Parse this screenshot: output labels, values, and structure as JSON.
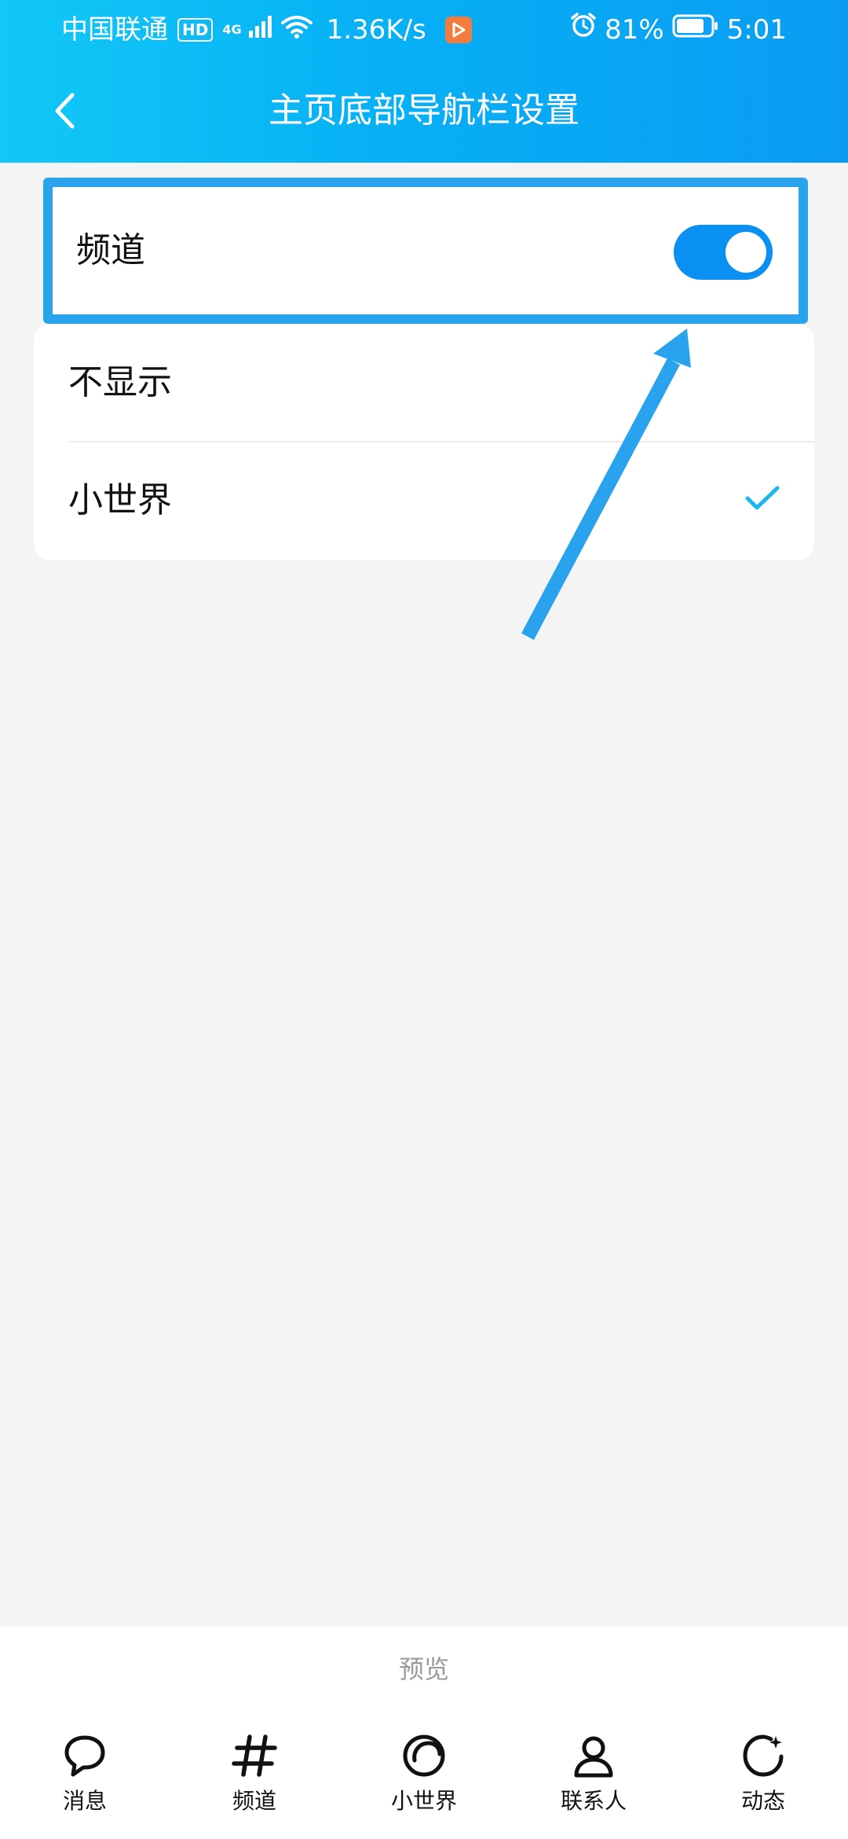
{
  "status_bar": {
    "carrier": "中国联通",
    "hd_badge": "HD",
    "network_badge": "4G",
    "speed": "1.36K/s",
    "battery_percent": "81%",
    "time": "5:01",
    "battery_level": 0.81
  },
  "header": {
    "title": "主页底部导航栏设置"
  },
  "channel_toggle": {
    "label": "频道",
    "on": true
  },
  "options": [
    {
      "label": "不显示",
      "selected": false
    },
    {
      "label": "小世界",
      "selected": true
    }
  ],
  "preview": {
    "label": "预览",
    "nav_items": [
      {
        "label": "消息",
        "icon": "message-bubble-icon"
      },
      {
        "label": "频道",
        "icon": "hash-icon"
      },
      {
        "label": "小世界",
        "icon": "small-world-icon"
      },
      {
        "label": "联系人",
        "icon": "person-icon"
      },
      {
        "label": "动态",
        "icon": "refresh-star-icon"
      }
    ]
  },
  "colors": {
    "header_gradient_start": "#12C8F7",
    "header_gradient_end": "#0A9CF3",
    "toggle_on": "#0A8FF3",
    "highlight_border": "#2AA3EE",
    "check": "#19B6F0",
    "background": "#F4F4F5"
  }
}
